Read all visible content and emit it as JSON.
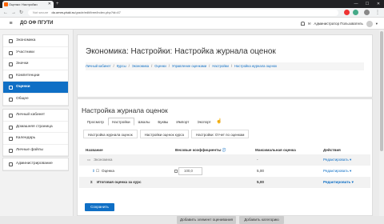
{
  "browser": {
    "tab_title": "Оценки: Настройки",
    "url_secure_label": "Not secure",
    "url_host": "do.omm-ptuki.ru",
    "url_path": "/grade/edit/tree/index.php?id=47"
  },
  "moodle": {
    "site_name": "ДО ОФ ПГУТИ",
    "user_name": "Администратор Пользователь"
  },
  "drawer": {
    "group1": [
      {
        "label": "Экономика",
        "icon": "cap-icon"
      },
      {
        "label": "Участники",
        "icon": "users-icon"
      },
      {
        "label": "Значки",
        "icon": "badge-icon"
      },
      {
        "label": "Компетенции",
        "icon": "check-icon"
      },
      {
        "label": "Оценки",
        "icon": "table-icon",
        "active": true
      },
      {
        "label": "Общее",
        "icon": "folder-icon"
      }
    ],
    "group2": [
      {
        "label": "Личный кабинет",
        "icon": "dashboard-icon"
      },
      {
        "label": "Домашняя страница",
        "icon": "home-icon"
      },
      {
        "label": "Календарь",
        "icon": "calendar-icon"
      },
      {
        "label": "Личные файлы",
        "icon": "file-icon"
      }
    ],
    "group3": [
      {
        "label": "Администрирование",
        "icon": "wrench-icon"
      }
    ]
  },
  "header": {
    "title": "Экономика: Настройки: Настройка журнала оценок",
    "breadcrumb": [
      "Личный кабинет",
      "Курсы",
      "Экономика",
      "Оценки",
      "Управление оценками",
      "Настройки",
      "Настройка журнала оценок"
    ]
  },
  "main": {
    "title": "Настройка журнала оценок",
    "tabs1": [
      "Просмотр",
      "Настройки",
      "Шкалы",
      "Буквы",
      "Импорт",
      "Экспорт"
    ],
    "tabs1_active": "Настройки",
    "tabs2": [
      "Настройка журнала оценок",
      "Настройки оценок курса",
      "Настройки: Отчет по оценкам"
    ],
    "table": {
      "headers": {
        "name": "Название",
        "weights": "Весовые коэффициенты",
        "max": "Максимальная оценка",
        "actions": "Действия"
      },
      "category": {
        "name": "Экономика",
        "max": "-",
        "action": "Редактировать ▾"
      },
      "item": {
        "name": "Оценка",
        "weight": "100,0",
        "max": "5,00",
        "action": "Редактировать ▾"
      },
      "total": {
        "name": "Итоговая оценка за курс",
        "max": "5,00",
        "action": "Редактировать ▾"
      }
    },
    "save_label": "Сохранить",
    "add_item_label": "Добавить элемент оценивания",
    "add_category_label": "Добавить категорию"
  },
  "colors": {
    "accent": "#0f6fc5",
    "active_nav": "#0f6fc5"
  }
}
